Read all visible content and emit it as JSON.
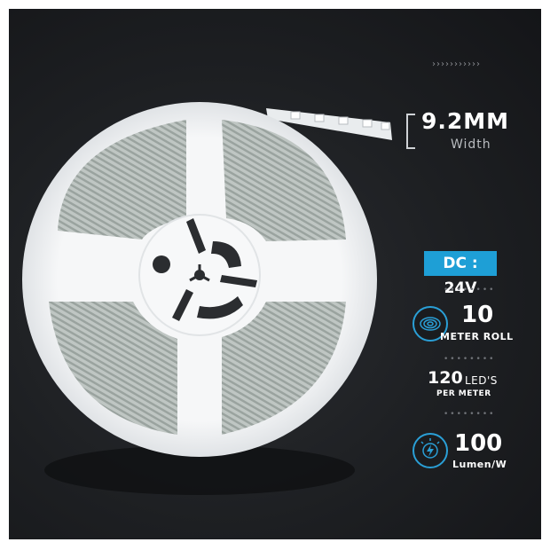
{
  "specs": {
    "width_value": "9.2MM",
    "width_label": "Width",
    "dc_badge": "DC : 24V",
    "roll_value": "10",
    "roll_label": "METER ROLL",
    "leds_value": "120",
    "leds_word": "LED'S",
    "leds_label": "PER METER",
    "lumen_value": "100",
    "lumen_label": "Lumen/W"
  },
  "decor": {
    "chevrons": "›››››››››››",
    "dots": "••••••••"
  },
  "colors": {
    "background": "#1d1f22",
    "accent": "#1e9fd6",
    "text": "#ffffff",
    "reel": "#f2f4f5"
  },
  "icons": [
    "coil-roll-icon",
    "lightning-bulb-icon"
  ]
}
